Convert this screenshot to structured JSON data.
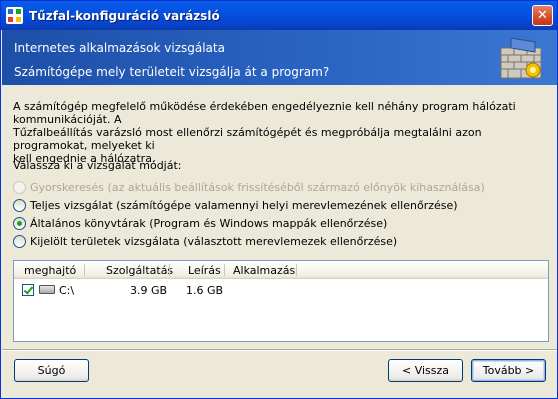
{
  "window": {
    "title": "Tűzfal-konfiguráció varázsló",
    "close_label": "✕"
  },
  "banner": {
    "title": "Internetes alkalmazások vizsgálata",
    "subtitle": "Számítógépe mely területeit vizsgálja át a program?"
  },
  "description": [
    "A számítógép megfelelő működése érdekében engedélyeznie kell néhány program hálózati kommunikációját. A",
    "Tűzfalbeállítás varázsló most ellenőrzi számítógépét és megpróbálja megtalálni azon programokat, melyeket ki",
    "kell engednie a hálózatra."
  ],
  "prompt": "Válassza ki a vizsgálat módját:",
  "options": [
    {
      "label": "Gyorskeresés (az aktuális beállítások frissítéséből származó előnyök kihasználása)",
      "checked": false,
      "disabled": true
    },
    {
      "label": "Teljes vizsgálat (számítógépe valamennyi helyi merevlemezének ellenőrzése)",
      "checked": false,
      "disabled": false
    },
    {
      "label": "Általános könyvtárak (Program és Windows mappák ellenőrzése)",
      "checked": true,
      "disabled": false
    },
    {
      "label": "Kijelölt területek vizsgálata (választott merevlemezek ellenőrzése)",
      "checked": false,
      "disabled": false
    }
  ],
  "table": {
    "columns": [
      "meghajtó",
      "Szolgáltatás",
      "Leírás",
      "Alkalmazás"
    ],
    "rows": [
      {
        "checked": true,
        "drive": "C:\\",
        "service": "3.9 GB",
        "description": "1.6 GB",
        "application": ""
      }
    ]
  },
  "buttons": {
    "help": "Súgó",
    "back": "< Vissza",
    "next": "Tovább >"
  },
  "colors": {
    "title_bar": "#0451e2",
    "banner": "#2b65c4",
    "radio_selected": "#21a121"
  }
}
